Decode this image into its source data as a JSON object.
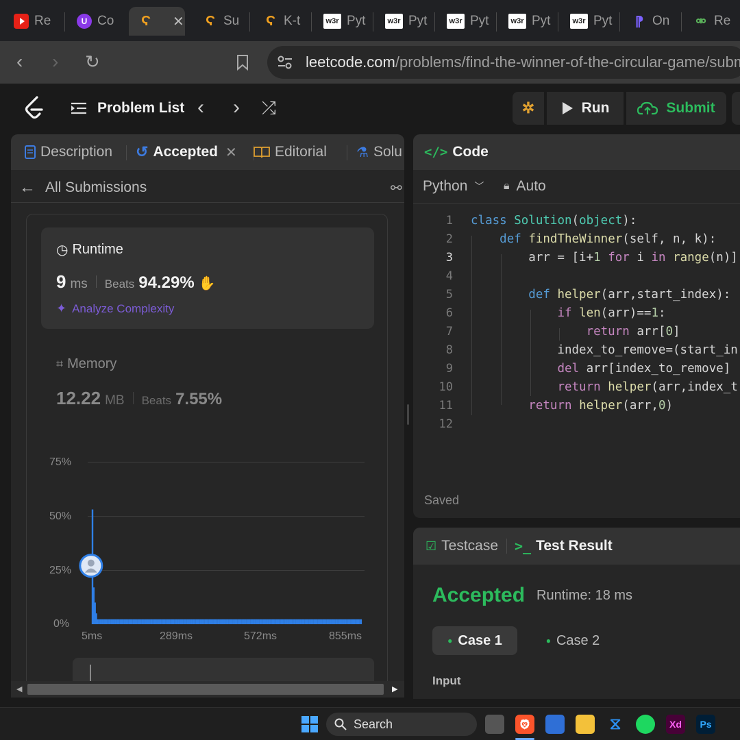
{
  "browser": {
    "tabs": [
      {
        "favicon": "youtube-icon",
        "label": "Re"
      },
      {
        "favicon": "copilot-icon",
        "label": "Co"
      },
      {
        "favicon": "leetcode-icon",
        "label": ""
      },
      {
        "favicon": "leetcode-icon",
        "label": "Su"
      },
      {
        "favicon": "leetcode-icon",
        "label": "K-t"
      },
      {
        "favicon": "w3schools-icon",
        "favicon_text": "w3r",
        "label": "Pyt"
      },
      {
        "favicon": "w3schools-icon",
        "favicon_text": "w3r",
        "label": "Pyt"
      },
      {
        "favicon": "w3schools-icon",
        "favicon_text": "w3r",
        "label": "Pyt"
      },
      {
        "favicon": "w3schools-icon",
        "favicon_text": "w3r",
        "label": "Pyt"
      },
      {
        "favicon": "w3schools-icon",
        "favicon_text": "w3r",
        "label": "Pyt"
      },
      {
        "favicon": "orbit-icon",
        "label": "On"
      },
      {
        "favicon": "link-icon",
        "label": "Re"
      }
    ],
    "active_tab_index": 2,
    "url_host": "leetcode.com",
    "url_path": "/problems/find-the-winner-of-the-circular-game/subm"
  },
  "header": {
    "problem_list": "Problem List",
    "run": "Run",
    "submit": "Submit"
  },
  "left_panel": {
    "tabs": [
      "Description",
      "Accepted",
      "Editorial",
      "Solu"
    ],
    "all_submissions": "All Submissions",
    "runtime": {
      "title": "Runtime",
      "value": "9",
      "unit": "ms",
      "beats_label": "Beats",
      "beats_value": "94.29%",
      "analyze": "Analyze Complexity"
    },
    "memory": {
      "title": "Memory",
      "value": "12.22",
      "unit": "MB",
      "beats_label": "Beats",
      "beats_value": "7.55%"
    }
  },
  "chart_data": {
    "type": "bar",
    "yticks": [
      "75%",
      "50%",
      "25%",
      "0%"
    ],
    "xticks": [
      "5ms",
      "289ms",
      "572ms",
      "855ms"
    ],
    "ylim": [
      0,
      75
    ],
    "xlim_ms": [
      5,
      855
    ],
    "bars_ms": [
      5,
      9,
      13,
      17
    ],
    "bar_values": [
      53,
      17,
      10,
      5
    ],
    "tail_value": 1,
    "marker_ms": 9,
    "marker_value": 27,
    "accent": "#2f7fe6"
  },
  "code_panel": {
    "title": "Code",
    "language": "Python",
    "mode": "Auto",
    "saved": "Saved",
    "line_numbers": [
      "1",
      "2",
      "3",
      "4",
      "5",
      "6",
      "7",
      "8",
      "9",
      "10",
      "11",
      "12"
    ],
    "lines": [
      "class Solution(object):",
      "    def findTheWinner(self, n, k):",
      "        arr = [i+1 for i in range(n)]",
      "",
      "        def helper(arr,start_index):",
      "            if len(arr)==1:",
      "                return arr[0]",
      "            index_to_remove=(start_in",
      "            del arr[index_to_remove]",
      "            return helper(arr,index_t",
      "        return helper(arr,0)",
      ""
    ]
  },
  "result_panel": {
    "tab_testcase": "Testcase",
    "tab_result": "Test Result",
    "status": "Accepted",
    "runtime": "Runtime: 18 ms",
    "case1": "Case 1",
    "case2": "Case 2",
    "input_label": "Input"
  },
  "taskbar": {
    "search": "Search"
  },
  "colors": {
    "accepted_green": "#2cbb5d",
    "chart_blue": "#2f7fe6",
    "analyze_purple": "#7c5cd6"
  }
}
